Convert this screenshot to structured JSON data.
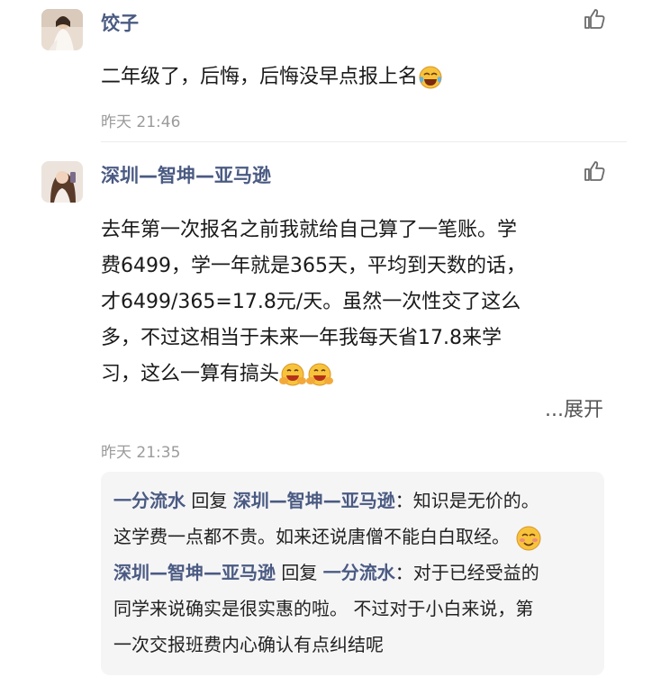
{
  "comments": [
    {
      "username": "饺子",
      "text": "二年级了，后悔，后悔没早点报上名",
      "time": "昨天 21:46",
      "avatar_icon": "woman-wedding-dress-avatar",
      "emoji_icon": "crying-laughing-emoji"
    },
    {
      "username": "深圳—智坤—亚马逊",
      "text_lines": [
        "去年第一次报名之前我就给自己算了一笔账。学",
        "费6499，学一年就是365天，平均到天数的话，",
        "才6499/365=17.8元/天。虽然一次性交了这么",
        "多，不过这相当于未来一年我每天省17.8来学",
        "习，这么一算有搞头"
      ],
      "expand_label": "...展开",
      "time": "昨天 21:35",
      "avatar_icon": "woman-selfie-avatar",
      "emoji_icon": "grinning-hands-emoji",
      "replies": [
        {
          "from": "一分流水",
          "reply_word": "回复",
          "to": "深圳—智坤—亚马逊",
          "colon": "：",
          "lines": [
            "知识是无价的。",
            "这学费一点都不贵。如来还说唐僧不能白白取经。"
          ],
          "emoji_icon": "smiling-blush-emoji"
        },
        {
          "from": "深圳—智坤—亚马逊",
          "reply_word": "回复",
          "to": "一分流水",
          "colon": "：",
          "lines": [
            "对于已经受益的",
            "同学来说确实是很实惠的啦。 不过对于小白来说，第",
            "一次交报班费内心确认有点纠结呢"
          ]
        }
      ]
    }
  ],
  "colors": {
    "username": "#4a5a82",
    "timestamp": "#9b9b9b",
    "reply_bg": "#f5f5f6",
    "text": "#1a1a1a"
  }
}
